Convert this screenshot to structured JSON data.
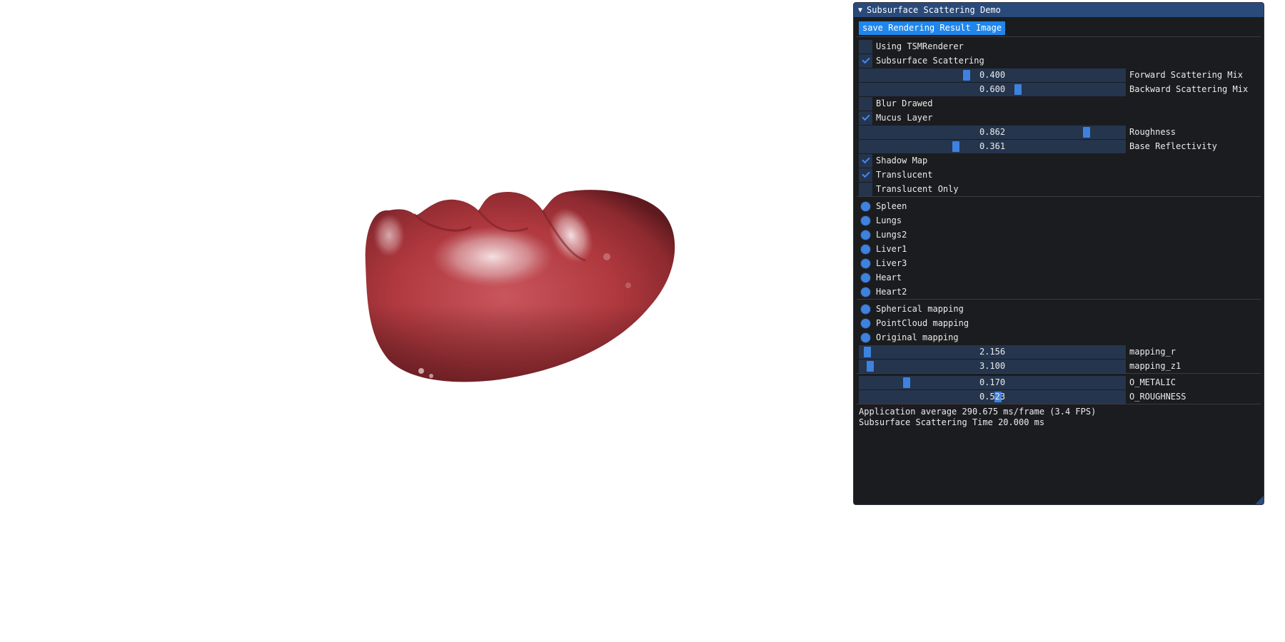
{
  "panel": {
    "title": "Subsurface Scattering Demo",
    "save_button": "save Rendering Result Image",
    "options": [
      {
        "type": "checkbox",
        "label": "Using TSMRenderer",
        "checked": false
      },
      {
        "type": "checkbox",
        "label": "Subsurface Scattering",
        "checked": true
      },
      {
        "type": "slider",
        "label": "Forward Scattering Mix",
        "value": "0.400",
        "level": 0.4
      },
      {
        "type": "slider",
        "label": "Backward Scattering Mix",
        "value": "0.600",
        "level": 0.6
      },
      {
        "type": "checkbox",
        "label": "Blur Drawed",
        "checked": false
      },
      {
        "type": "checkbox",
        "label": "Mucus Layer",
        "checked": true
      },
      {
        "type": "slider",
        "label": "Roughness",
        "value": "0.862",
        "level": 0.862
      },
      {
        "type": "slider",
        "label": "Base Reflectivity",
        "value": "0.361",
        "level": 0.361
      },
      {
        "type": "checkbox",
        "label": "Shadow Map",
        "checked": true
      },
      {
        "type": "checkbox",
        "label": "Translucent",
        "checked": true
      },
      {
        "type": "checkbox",
        "label": "Translucent Only",
        "checked": false
      }
    ],
    "organs": [
      "Spleen",
      "Lungs",
      "Lungs2",
      "Liver1",
      "Liver3",
      "Heart",
      "Heart2"
    ],
    "mappings": [
      "Spherical mapping",
      "PointCloud mapping",
      "Original mapping"
    ],
    "mapping_sliders": [
      {
        "label": "mapping_r",
        "value": "2.156",
        "level": 0.02
      },
      {
        "label": "mapping_z1",
        "value": "3.100",
        "level": 0.03
      }
    ],
    "material_sliders": [
      {
        "label": "O_METALIC",
        "value": "0.170",
        "level": 0.17
      },
      {
        "label": "O_ROUGHNESS",
        "value": "0.523",
        "level": 0.523
      }
    ],
    "stats": [
      "Application average 290.675 ms/frame (3.4 FPS)",
      "Subsurface Scattering Time 20.000 ms"
    ]
  },
  "colors": {
    "panel_bg": "#1b1c1f",
    "title_bg": "#294a7a",
    "accent": "#3e82e0",
    "button": "#1f86ec",
    "frame": "#25354d"
  }
}
